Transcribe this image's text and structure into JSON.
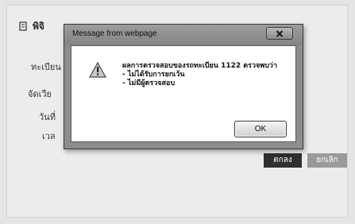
{
  "page": {
    "header_title": "พิจิ",
    "form_labels": [
      "ทะเบียน",
      "จัดเวีย",
      "วันที่",
      "เวล"
    ],
    "buttons": {
      "primary_label": "ตกลง",
      "secondary_label": "ยกเลิก"
    }
  },
  "dialog": {
    "title": "Message from webpage",
    "message_lines": [
      "ผลการตรวจสอบของรถทะเบียน 1122 ตรวจพบว่า",
      "- ไม่ได้รับการยกเว้น",
      "- ไม่มีผู้ตรวจสอบ"
    ],
    "ok_label": "OK",
    "icon": "warning-icon",
    "close_icon": "close-icon"
  },
  "colors": {
    "primary_button": "#2f2f2f",
    "secondary_button": "#9a9a9a",
    "dialog_frame": "#8d8d8d"
  }
}
